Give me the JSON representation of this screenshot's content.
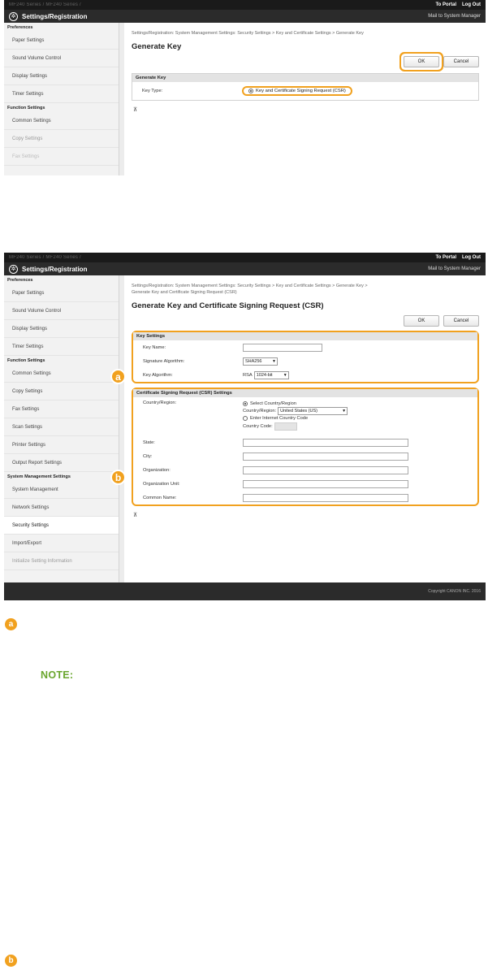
{
  "topbar": {
    "product_crumb": "MF240 Series / MF240 Series /",
    "to_portal": "To Portal",
    "log_out": "Log Out"
  },
  "app": {
    "title": "Settings/Registration",
    "mail_button": "Mail to System Manager",
    "logo_icon": "gear-circle-icon"
  },
  "screen1": {
    "sidebar": [
      {
        "type": "head",
        "label": "Preferences"
      },
      {
        "type": "item",
        "label": "Paper Settings"
      },
      {
        "type": "item",
        "label": "Sound Volume Control"
      },
      {
        "type": "item",
        "label": "Display Settings"
      },
      {
        "type": "item",
        "label": "Timer Settings"
      },
      {
        "type": "head",
        "label": "Function Settings"
      },
      {
        "type": "item",
        "label": "Common Settings"
      },
      {
        "type": "item",
        "label": "Copy Settings",
        "fade": 1
      },
      {
        "type": "item",
        "label": "Fax Settings",
        "fade": 2
      }
    ],
    "breadcrumb": "Settings/Registration: System Management Settings: Security Settings > Key and Certificate Settings > Generate Key",
    "title": "Generate Key",
    "ok": "OK",
    "cancel": "Cancel",
    "section_title": "Generate Key",
    "key_type_label": "Key Type:",
    "key_type_option": "Key and Certificate Signing Request (CSR)"
  },
  "screen2": {
    "sidebar": [
      {
        "type": "head",
        "label": "Preferences"
      },
      {
        "type": "item",
        "label": "Paper Settings"
      },
      {
        "type": "item",
        "label": "Sound Volume Control"
      },
      {
        "type": "item",
        "label": "Display Settings"
      },
      {
        "type": "item",
        "label": "Timer Settings"
      },
      {
        "type": "head",
        "label": "Function Settings"
      },
      {
        "type": "item",
        "label": "Common Settings"
      },
      {
        "type": "item",
        "label": "Copy Settings"
      },
      {
        "type": "item",
        "label": "Fax Settings"
      },
      {
        "type": "item",
        "label": "Scan Settings"
      },
      {
        "type": "item",
        "label": "Printer Settings"
      },
      {
        "type": "item",
        "label": "Output Report Settings"
      },
      {
        "type": "head",
        "label": "System Management Settings"
      },
      {
        "type": "item",
        "label": "System Management"
      },
      {
        "type": "item",
        "label": "Network Settings"
      },
      {
        "type": "item",
        "label": "Security Settings",
        "active": true
      },
      {
        "type": "item",
        "label": "Import/Export"
      },
      {
        "type": "item",
        "label": "Initialize Setting Information",
        "fade": 1
      }
    ],
    "breadcrumb_line1": "Settings/Registration: System Management Settings: Security Settings > Key and Certificate Settings > Generate Key >",
    "breadcrumb_line2": "Generate Key and Certificate Signing Request (CSR)",
    "title": "Generate Key and Certificate Signing Request (CSR)",
    "ok": "OK",
    "cancel": "Cancel",
    "key_settings": {
      "title": "Key Settings",
      "key_name_label": "Key Name:",
      "signature_label": "Signature Algorithm:",
      "signature_value": "SHA256",
      "key_algorithm_label": "Key Algorithm:",
      "key_algorithm_prefix": "RSA",
      "key_algorithm_value": "1024-bit"
    },
    "csr": {
      "title": "Certificate Signing Request (CSR) Settings",
      "country_label": "Country/Region:",
      "select_country": "Select Country/Region",
      "country_sub_label": "Country/Region:",
      "country_value": "United States (US)",
      "enter_code": "Enter Internet Country Code",
      "country_code_label": "Country Code:",
      "state_label": "State:",
      "city_label": "City:",
      "org_label": "Organization:",
      "org_unit_label": "Organization Unit:",
      "common_name_label": "Common Name:"
    },
    "footer": "Copyright CANON INC. 2016"
  },
  "callouts": {
    "a": "a",
    "b": "b"
  },
  "note_label": "NOTE:",
  "accent_color": "#f1a11f",
  "note_color": "#6aa62e"
}
